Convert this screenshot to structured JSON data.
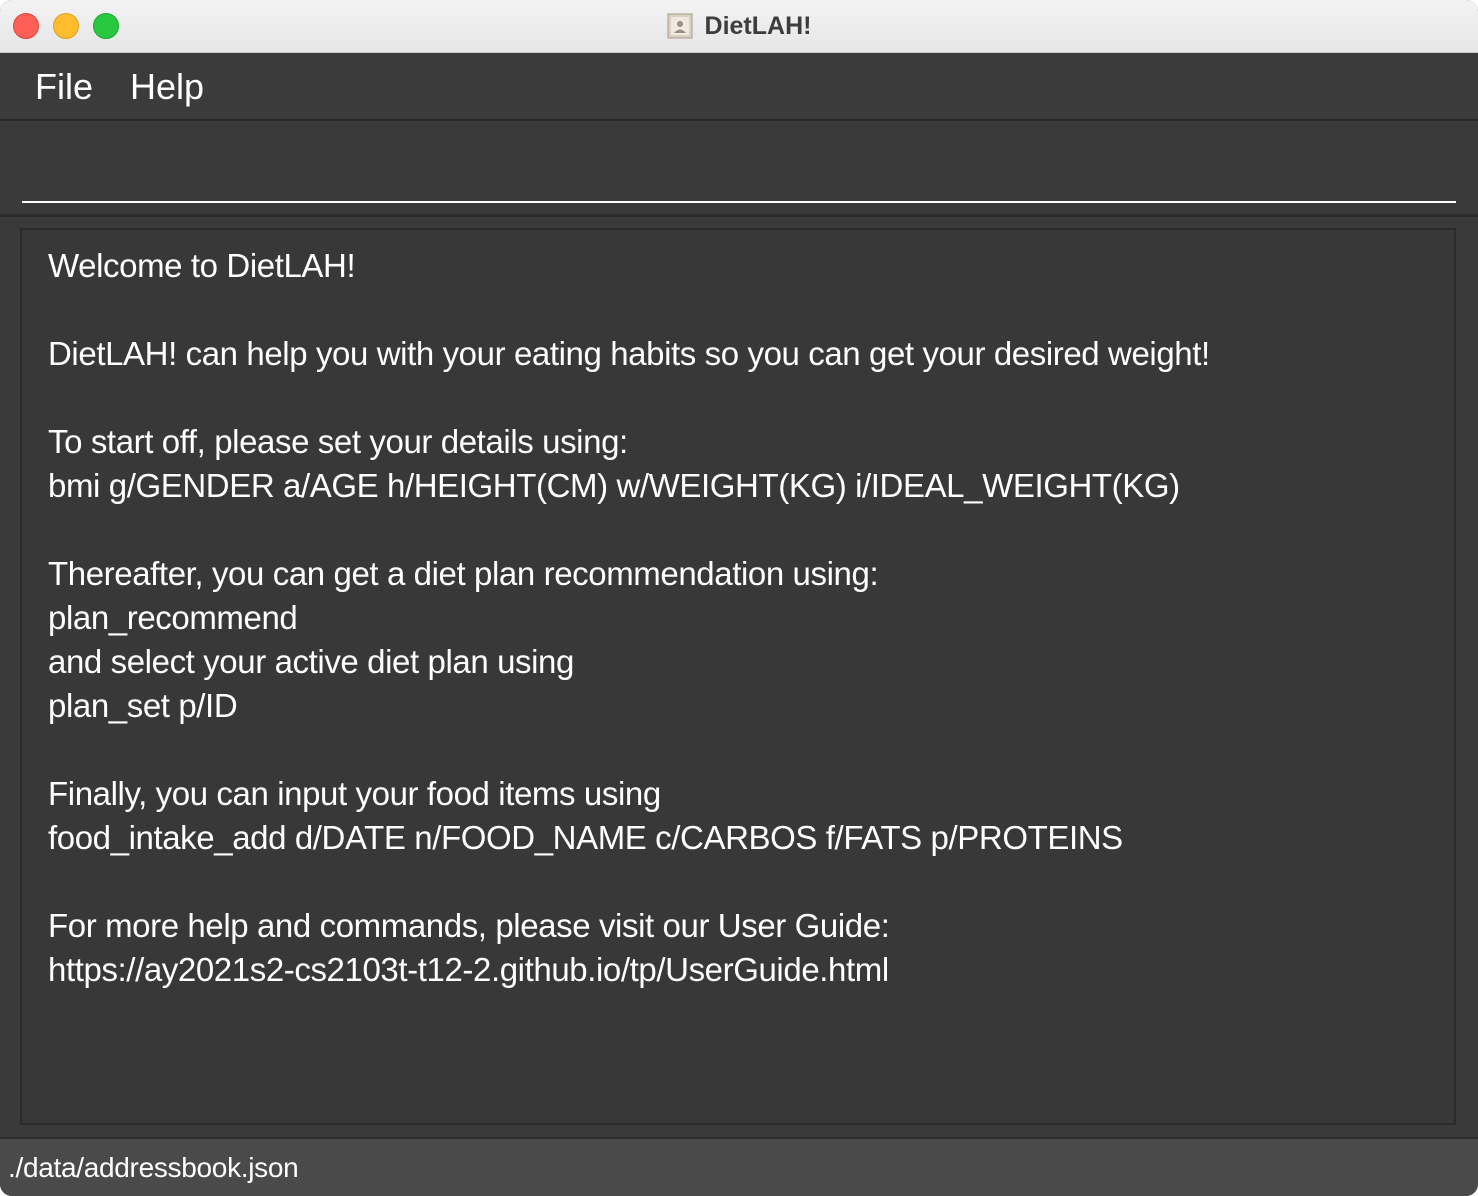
{
  "window": {
    "title": "DietLAH!"
  },
  "menu": {
    "items": [
      {
        "label": "File"
      },
      {
        "label": "Help"
      }
    ]
  },
  "command_box": {
    "value": "",
    "placeholder": ""
  },
  "result_display": {
    "text": "Welcome to DietLAH!\n\nDietLAH! can help you with your eating habits so you can get your desired weight!\n\nTo start off, please set your details using:\nbmi g/GENDER a/AGE h/HEIGHT(CM) w/WEIGHT(KG) i/IDEAL_WEIGHT(KG)\n\nThereafter, you can get a diet plan recommendation using:\nplan_recommend\nand select your active diet plan using\nplan_set p/ID\n\nFinally, you can input your food items using\nfood_intake_add d/DATE n/FOOD_NAME c/CARBOS f/FATS p/PROTEINS\n\nFor more help and commands, please visit our User Guide:\nhttps://ay2021s2-cs2103t-t12-2.github.io/tp/UserGuide.html"
  },
  "status_bar": {
    "path": "./data/addressbook.json"
  },
  "colors": {
    "close": "#fe5f57",
    "minimize": "#febc2e",
    "zoom": "#28c840",
    "background": "#3a3a3a",
    "text": "#ffffff"
  }
}
